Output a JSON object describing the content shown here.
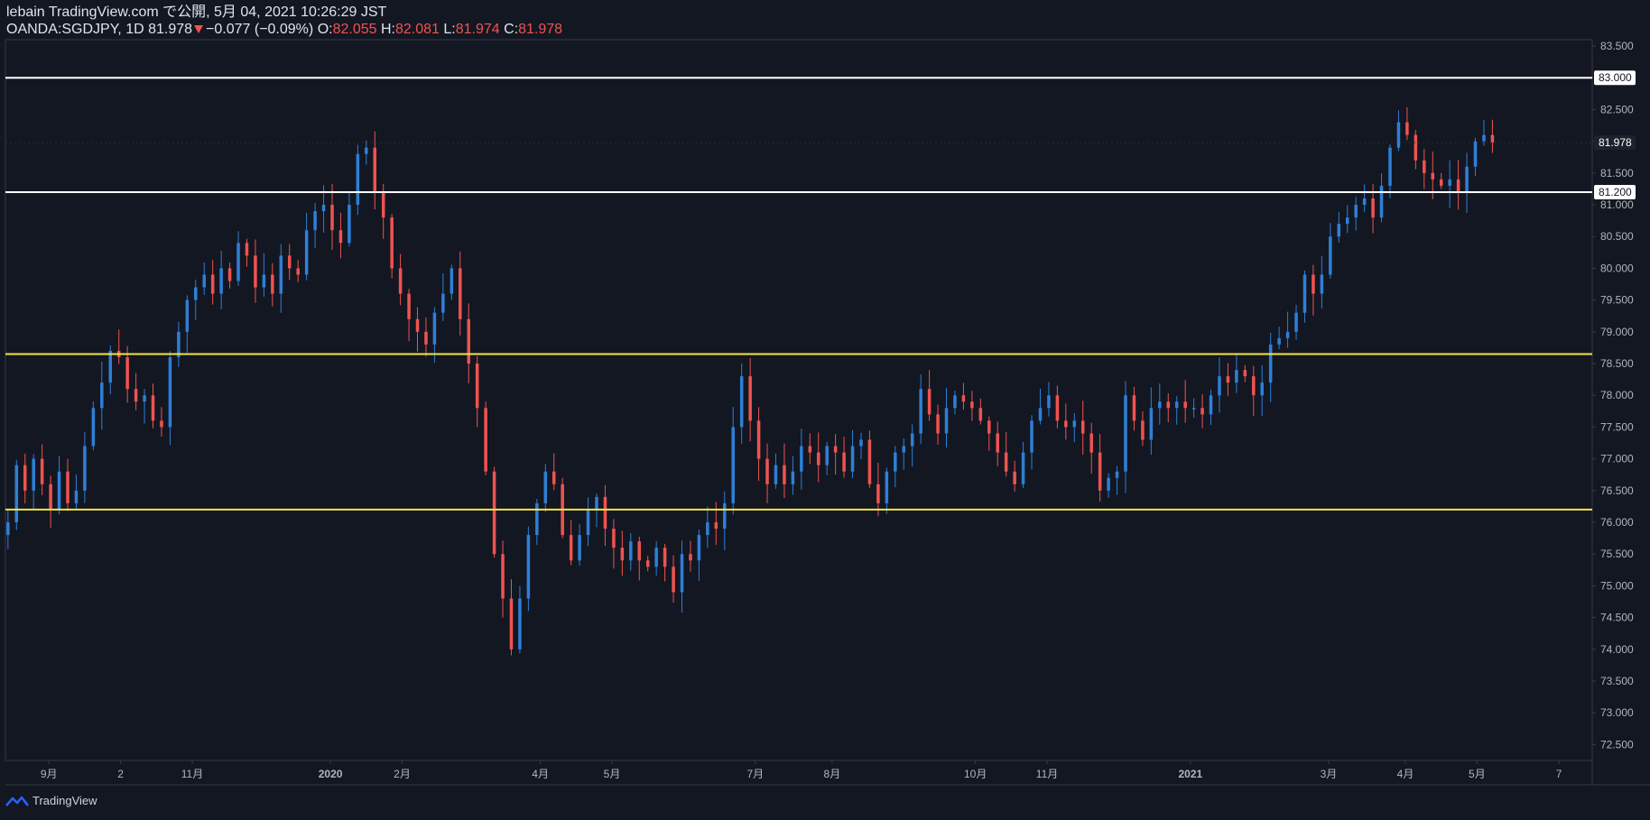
{
  "header": {
    "publisher_line": "lebain TradingView.com で公開, 5月 04, 2021 10:26:29 JST",
    "symbol": "OANDA:SGDJPY, 1D",
    "last": "81.978",
    "change": "−0.077 (−0.09%)",
    "o_label": "O:",
    "o_value": "82.055",
    "h_label": "H:",
    "h_value": "82.081",
    "l_label": "L:",
    "l_value": "81.974",
    "c_label": "C:",
    "c_value": "81.978"
  },
  "footer": {
    "logo_text": "TradingView"
  },
  "colors": {
    "background": "#131722",
    "up": "#2e7fd6",
    "down": "#ef5350",
    "yellow_line": "#f5e642",
    "white_line": "#ffffff",
    "axis_text": "#b2b5be",
    "border": "#363a45"
  },
  "chart_data": {
    "type": "candlestick",
    "symbol": "OANDA:SGDJPY",
    "interval": "1D",
    "ylim": [
      72.25,
      83.6
    ],
    "y_ticks": [
      "83.500",
      "83.000",
      "82.500",
      "82.000",
      "81.500",
      "81.000",
      "80.500",
      "80.000",
      "79.500",
      "79.000",
      "78.500",
      "78.000",
      "77.500",
      "77.000",
      "76.500",
      "76.000",
      "75.500",
      "75.000",
      "74.500",
      "74.000",
      "73.500",
      "73.000",
      "72.500"
    ],
    "x_ticks": [
      {
        "label": "9月",
        "bar": 8
      },
      {
        "label": "2",
        "bar": 22
      },
      {
        "label": "11月",
        "bar": 36
      },
      {
        "label": "2020",
        "bar": 63
      },
      {
        "label": "2月",
        "bar": 77
      },
      {
        "label": "4月",
        "bar": 104
      },
      {
        "label": "5月",
        "bar": 118
      },
      {
        "label": "7月",
        "bar": 146
      },
      {
        "label": "8月",
        "bar": 161
      },
      {
        "label": "10月",
        "bar": 189
      },
      {
        "label": "11月",
        "bar": 203
      },
      {
        "label": "2021",
        "bar": 231
      },
      {
        "label": "3月",
        "bar": 258
      },
      {
        "label": "4月",
        "bar": 273
      },
      {
        "label": "5月",
        "bar": 287
      },
      {
        "label": "7",
        "bar": 303
      }
    ],
    "horizontal_lines": [
      {
        "price": 83.0,
        "color": "white",
        "label": "83.000"
      },
      {
        "price": 81.2,
        "color": "white",
        "label": "81.200"
      },
      {
        "price": 78.65,
        "color": "yellow"
      },
      {
        "price": 76.2,
        "color": "yellow"
      }
    ],
    "last_price_label": "81.978",
    "last_price": 81.978,
    "close_series": [
      76.0,
      76.9,
      76.5,
      77.0,
      76.6,
      76.2,
      76.8,
      76.3,
      76.5,
      77.2,
      77.8,
      78.2,
      78.7,
      78.6,
      78.1,
      77.9,
      78.0,
      77.6,
      77.5,
      78.6,
      79.0,
      79.5,
      79.7,
      79.9,
      79.6,
      80.0,
      79.8,
      80.4,
      80.2,
      79.7,
      79.9,
      79.6,
      80.2,
      80.0,
      79.9,
      80.6,
      80.9,
      81.0,
      80.6,
      80.4,
      81.0,
      81.8,
      81.9,
      81.2,
      80.8,
      80.0,
      79.6,
      79.2,
      79.0,
      78.8,
      79.3,
      79.6,
      80.0,
      79.2,
      78.5,
      77.8,
      76.8,
      75.5,
      74.8,
      74.0,
      74.8,
      75.8,
      76.3,
      76.8,
      76.6,
      75.8,
      75.4,
      75.8,
      76.2,
      76.4,
      75.9,
      75.6,
      75.4,
      75.7,
      75.4,
      75.3,
      75.6,
      75.3,
      74.9,
      75.5,
      75.4,
      75.8,
      76.0,
      75.9,
      76.3,
      77.5,
      78.3,
      77.6,
      77.0,
      76.6,
      76.9,
      76.6,
      76.8,
      77.2,
      77.1,
      76.9,
      77.2,
      77.1,
      76.8,
      77.2,
      77.3,
      76.6,
      76.3,
      76.8,
      77.1,
      77.2,
      77.4,
      78.1,
      77.7,
      77.4,
      77.8,
      78.0,
      77.9,
      77.8,
      77.6,
      77.4,
      77.1,
      76.8,
      76.6,
      77.1,
      77.6,
      77.8,
      78.0,
      77.6,
      77.5,
      77.6,
      77.4,
      77.1,
      76.5,
      76.7,
      76.8,
      78.0,
      77.6,
      77.3,
      77.8,
      77.9,
      77.8,
      77.9,
      77.8,
      77.8,
      77.7,
      78.0,
      78.3,
      78.2,
      78.4,
      78.3,
      78.0,
      78.2,
      78.8,
      78.9,
      79.0,
      79.3,
      79.9,
      79.6,
      79.9,
      80.5,
      80.7,
      80.8,
      81.0,
      81.1,
      80.8,
      81.3,
      81.9,
      82.3,
      82.1,
      81.7,
      81.5,
      81.4,
      81.3,
      81.4,
      81.2,
      81.6,
      82.0,
      82.1,
      81.978
    ]
  }
}
